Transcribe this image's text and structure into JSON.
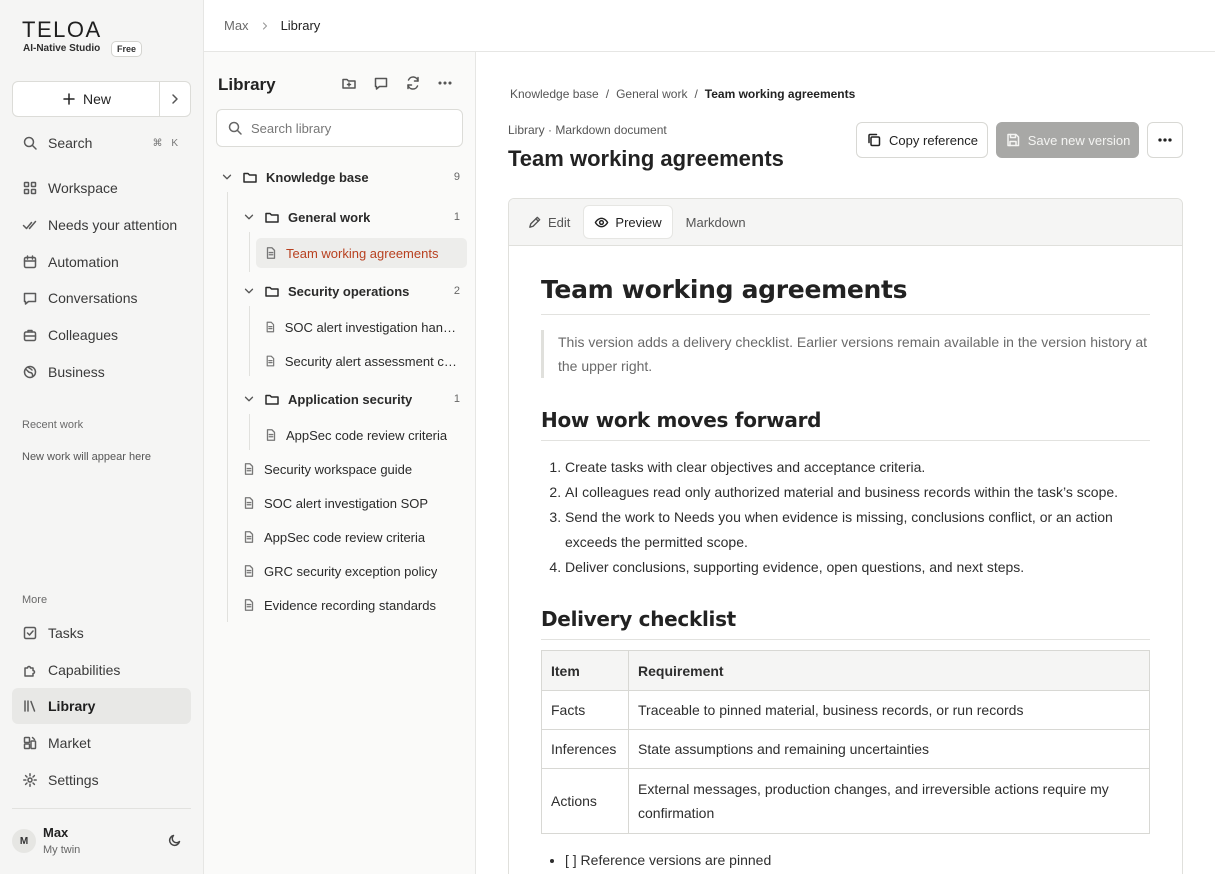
{
  "brand": {
    "logo": "TELOA",
    "tagline": "AI-Native Studio",
    "plan": "Free"
  },
  "sidebar": {
    "new_label": "New",
    "search": {
      "label": "Search",
      "shortcut": "⌘ K"
    },
    "main_items": [
      {
        "label": "Workspace",
        "icon": "grid-icon"
      },
      {
        "label": "Needs your attention",
        "icon": "check-double-icon"
      },
      {
        "label": "Automation",
        "icon": "calendar-icon"
      },
      {
        "label": "Conversations",
        "icon": "chat-icon"
      },
      {
        "label": "Colleagues",
        "icon": "briefcase-icon"
      },
      {
        "label": "Business",
        "icon": "globe-icon"
      }
    ],
    "recent_label": "Recent work",
    "recent_empty": "New work will appear here",
    "more_label": "More",
    "more_items": [
      {
        "label": "Tasks",
        "icon": "checkbox-icon"
      },
      {
        "label": "Capabilities",
        "icon": "puzzle-icon"
      },
      {
        "label": "Library",
        "icon": "books-icon",
        "active": true
      },
      {
        "label": "Market",
        "icon": "store-icon"
      },
      {
        "label": "Settings",
        "icon": "gear-icon"
      }
    ],
    "user": {
      "initial": "M",
      "name": "Max",
      "subtitle": "My twin"
    }
  },
  "topbar": {
    "crumbs": [
      "Max",
      "Library"
    ]
  },
  "library": {
    "title": "Library",
    "search_placeholder": "Search library",
    "tree": [
      {
        "type": "folder",
        "label": "Knowledge base",
        "count": "9"
      },
      {
        "type": "folder",
        "label": "General work",
        "count": "1"
      },
      {
        "type": "doc",
        "label": "Team working agreements",
        "selected": true
      },
      {
        "type": "folder",
        "label": "Security operations",
        "count": "2"
      },
      {
        "type": "doc",
        "label": "SOC alert investigation handbook"
      },
      {
        "type": "doc",
        "label": "Security alert assessment criteria"
      },
      {
        "type": "folder",
        "label": "Application security",
        "count": "1"
      },
      {
        "type": "doc",
        "label": "AppSec code review criteria"
      },
      {
        "type": "doc",
        "label": "Security workspace guide"
      },
      {
        "type": "doc",
        "label": "SOC alert investigation SOP"
      },
      {
        "type": "doc",
        "label": "AppSec code review criteria"
      },
      {
        "type": "doc",
        "label": "GRC security exception policy"
      },
      {
        "type": "doc",
        "label": "Evidence recording standards"
      }
    ]
  },
  "document": {
    "breadcrumbs": [
      "Knowledge base",
      "General work",
      "Team working agreements"
    ],
    "meta": "Library · Markdown document",
    "title": "Team working agreements",
    "actions": {
      "copy": "Copy reference",
      "save": "Save new version"
    },
    "tabs": [
      "Edit",
      "Preview",
      "Markdown"
    ],
    "active_tab": "Preview",
    "body": {
      "h1": "Team working agreements",
      "quote": "This version adds a delivery checklist. Earlier versions remain available in the version history at the upper right.",
      "h2_a": "How work moves forward",
      "steps": [
        "Create tasks with clear objectives and acceptance criteria.",
        "AI colleagues read only authorized material and business records within the task’s scope.",
        "Send the work to Needs you when evidence is missing, conclusions conflict, or an action exceeds the permitted scope.",
        "Deliver conclusions, supporting evidence, open questions, and next steps."
      ],
      "h2_b": "Delivery checklist",
      "table": {
        "headers": [
          "Item",
          "Requirement"
        ],
        "rows": [
          [
            "Facts",
            "Traceable to pinned material, business records, or run records"
          ],
          [
            "Inferences",
            "State assumptions and remaining uncertainties"
          ],
          [
            "Actions",
            "External messages, production changes, and irreversible actions require my confirmation"
          ]
        ]
      },
      "checklist": [
        "[ ] Reference versions are pinned"
      ]
    }
  },
  "colors": {
    "accent_selected": "#b8401f",
    "save_disabled": "#a8a8a6",
    "sidebar_bg": "#f5f5f4"
  }
}
